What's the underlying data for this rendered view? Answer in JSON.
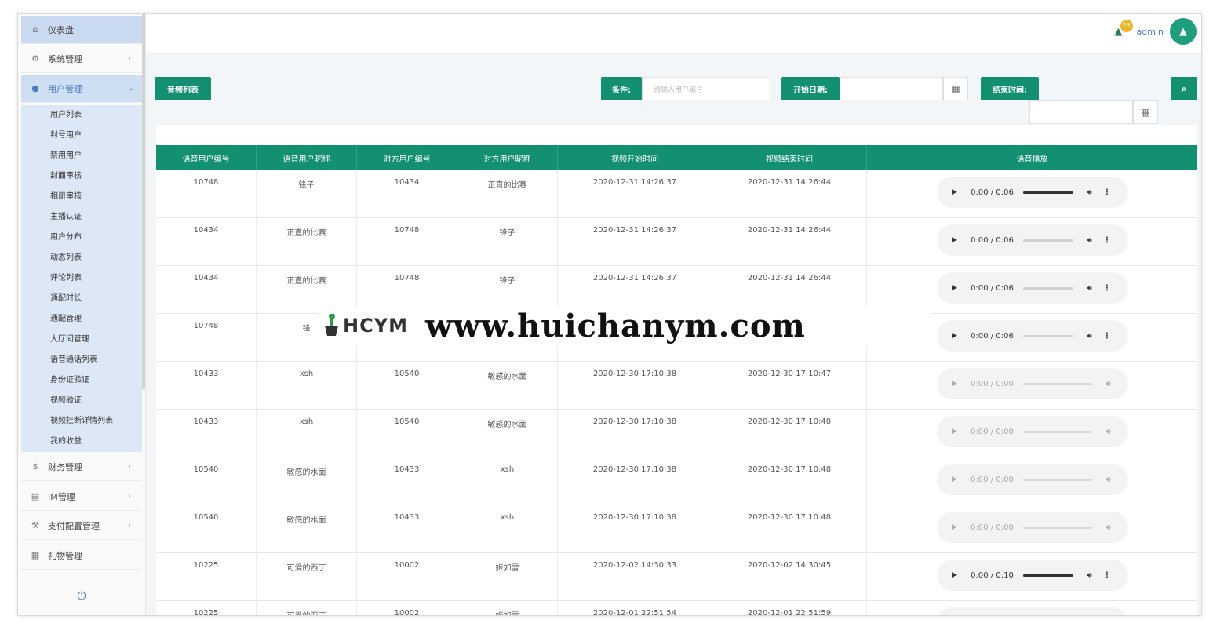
{
  "sidebar": {
    "top_items": [
      {
        "icon": "home-icon",
        "label": "仪表盘"
      },
      {
        "icon": "gears-icon",
        "label": "系统管理"
      },
      {
        "icon": "user-icon",
        "label": "用户管理"
      }
    ],
    "sub_items": [
      "用户列表",
      "封号用户",
      "禁用用户",
      "封面审核",
      "相册审核",
      "主播认证",
      "用户分布",
      "动态列表",
      "评论列表",
      "通配时长",
      "通配管理",
      "大厅间管理",
      "语音通话列表",
      "身份证验证",
      "视频验证",
      "视频挂断详情列表",
      "我的收益"
    ],
    "bottom_items": [
      {
        "icon": "dollar-icon",
        "label": "财务管理"
      },
      {
        "icon": "im-icon",
        "label": "IM管理"
      },
      {
        "icon": "wrench-icon",
        "label": "支付配置管理"
      },
      {
        "icon": "gift-icon",
        "label": "礼物管理"
      }
    ]
  },
  "header": {
    "badge_count": "23",
    "username": "admin"
  },
  "toolbar": {
    "list_button": "音频列表",
    "condition_label": "条件:",
    "condition_placeholder": "请输入用户编号",
    "start_date_label": "开始日期:",
    "end_time_label": "结束时间:"
  },
  "table": {
    "headers": [
      "语音用户编号",
      "语音用户昵称",
      "对方用户编号",
      "对方用户昵称",
      "视频开始时间",
      "视频结束时间",
      "语音播放"
    ],
    "rows": [
      {
        "uid": "10748",
        "nick": "锋子",
        "oid": "10434",
        "onick": "正直的比赛",
        "start": "2020-12-31 14:26:37",
        "end": "2020-12-31 14:26:44",
        "time": "0:00 / 0:06",
        "enabled": true,
        "progress": 1
      },
      {
        "uid": "10434",
        "nick": "正直的比赛",
        "oid": "10748",
        "onick": "锋子",
        "start": "2020-12-31 14:26:37",
        "end": "2020-12-31 14:26:44",
        "time": "0:00 / 0:06",
        "enabled": true,
        "progress": 0
      },
      {
        "uid": "10434",
        "nick": "正直的比赛",
        "oid": "10748",
        "onick": "锋子",
        "start": "2020-12-31 14:26:37",
        "end": "2020-12-31 14:26:44",
        "time": "0:00 / 0:06",
        "enabled": true,
        "progress": 0
      },
      {
        "uid": "10748",
        "nick": "锋",
        "oid": "",
        "onick": "",
        "start": "",
        "end": "",
        "time": "0:00 / 0:06",
        "enabled": true,
        "progress": 0
      },
      {
        "uid": "10433",
        "nick": "xsh",
        "oid": "10540",
        "onick": "敏感的水面",
        "start": "2020-12-30 17:10:38",
        "end": "2020-12-30 17:10:47",
        "time": "0:00 / 0:00",
        "enabled": false,
        "progress": 0
      },
      {
        "uid": "10433",
        "nick": "xsh",
        "oid": "10540",
        "onick": "敏感的水面",
        "start": "2020-12-30 17:10:38",
        "end": "2020-12-30 17:10:48",
        "time": "0:00 / 0:00",
        "enabled": false,
        "progress": 0
      },
      {
        "uid": "10540",
        "nick": "敏感的水面",
        "oid": "10433",
        "onick": "xsh",
        "start": "2020-12-30 17:10:38",
        "end": "2020-12-30 17:10:48",
        "time": "0:00 / 0:00",
        "enabled": false,
        "progress": 0
      },
      {
        "uid": "10540",
        "nick": "敏感的水面",
        "oid": "10433",
        "onick": "xsh",
        "start": "2020-12-30 17:10:38",
        "end": "2020-12-30 17:10:48",
        "time": "0:00 / 0:00",
        "enabled": false,
        "progress": 0
      },
      {
        "uid": "10225",
        "nick": "可爱的西丁",
        "oid": "10002",
        "onick": "姬如雪",
        "start": "2020-12-02 14:30:33",
        "end": "2020-12-02 14:30:45",
        "time": "0:00 / 0:10",
        "enabled": true,
        "progress": 1
      },
      {
        "uid": "10225",
        "nick": "可爱的西丁",
        "oid": "10002",
        "onick": "姬如雪",
        "start": "2020-12-01 22:51:54",
        "end": "2020-12-01 22:51:59",
        "time": "",
        "enabled": true,
        "progress": 0
      }
    ]
  },
  "watermark": {
    "brand": "HCYM",
    "url": "www.huichanym.com"
  },
  "colors": {
    "accent": "#138f72",
    "sidebar_active": "#cfdff3",
    "link": "#4a7cc4",
    "badge": "#f0b429"
  }
}
